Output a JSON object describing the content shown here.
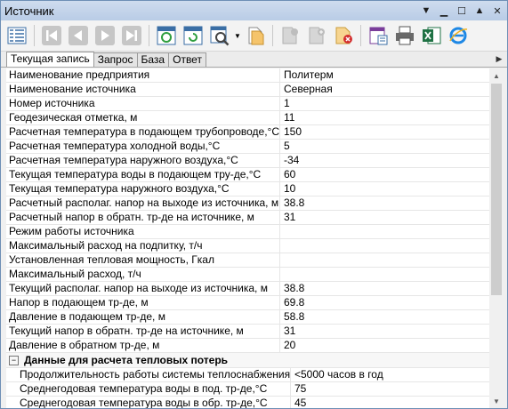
{
  "window": {
    "title": "Источник"
  },
  "tabs": [
    "Текущая запись",
    "Запрос",
    "База",
    "Ответ"
  ],
  "rows": [
    {
      "name": "Наименование предприятия",
      "value": "Политерм"
    },
    {
      "name": "Наименование источника",
      "value": "Северная"
    },
    {
      "name": "Номер источника",
      "value": "1"
    },
    {
      "name": "Геодезическая отметка, м",
      "value": "11"
    },
    {
      "name": "Расчетная температура в подающем трубопроводе,°С",
      "value": "150"
    },
    {
      "name": "Расчетная температура холодной воды,°С",
      "value": "5"
    },
    {
      "name": "Расчетная температура наружного воздуха,°С",
      "value": "-34"
    },
    {
      "name": "Текущая температура воды в подающем тру-де,°С",
      "value": "60"
    },
    {
      "name": "Текущая температура  наружного воздуха,°С",
      "value": "10"
    },
    {
      "name": "Расчетный располаг. напор на выходе из источника, м",
      "value": "38.8"
    },
    {
      "name": "Расчетный напор в обратн. тр-де на источнике, м",
      "value": "31"
    },
    {
      "name": "Режим работы источника",
      "value": ""
    },
    {
      "name": "Максимальный расход на подпитку, т/ч",
      "value": ""
    },
    {
      "name": "Установленная тепловая мощность, Гкал",
      "value": ""
    },
    {
      "name": "Максимальный расход, т/ч",
      "value": ""
    },
    {
      "name": "Текущий располаг. напор на выходе из источника, м",
      "value": "38.8"
    },
    {
      "name": "Напор в подающем тр-де, м",
      "value": "69.8"
    },
    {
      "name": "Давление в подающем тр-де, м",
      "value": "58.8"
    },
    {
      "name": "Текущий напор в обратн. тр-де на источнике, м",
      "value": "31"
    },
    {
      "name": "Давление в обратном тр-де, м",
      "value": "20"
    }
  ],
  "category": {
    "toggle": "−",
    "label": "Данные для расчета тепловых потерь",
    "rows": [
      {
        "name": "Продолжительность работы системы теплоснабжения",
        "value": "<5000 часов в год"
      },
      {
        "name": "Среднегодовая температура воды в под. тр-де,°С",
        "value": "75"
      },
      {
        "name": "Среднегодовая температура воды в обр. тр-де,°С",
        "value": "45"
      }
    ]
  },
  "icons": [
    "grid-view-icon",
    "first-record-icon",
    "prev-record-icon",
    "next-record-icon",
    "last-record-icon",
    "refresh-icon",
    "reload-icon",
    "find-icon",
    "copy-icon",
    "save-record-icon",
    "add-record-icon",
    "delete-record-icon",
    "report-icon",
    "print-icon",
    "excel-icon",
    "ie-icon"
  ]
}
